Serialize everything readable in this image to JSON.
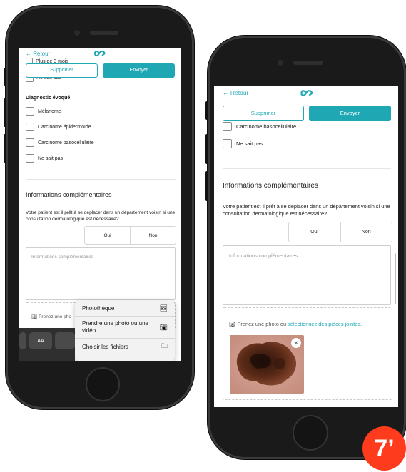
{
  "left": {
    "nav": {
      "back": "← Retour"
    },
    "buttons": {
      "delete": "Supprimer",
      "send": "Envoyer"
    },
    "partial_options": [
      "Plus de 3 mois",
      "Ne sait pas"
    ],
    "diagnostic": {
      "title": "Diagnostic évoqué",
      "options": [
        "Mélanome",
        "Carcinome épidermoïde",
        "Carcinome basocellulaire",
        "Ne sait pas"
      ]
    },
    "info": {
      "title": "Informations complémentaires",
      "question": "Votre patient est il prêt à se déplacer dans un département voisin si une consultation dermatologique est nécessaire?",
      "yes": "Oui",
      "no": "Non",
      "placeholder": "Informations complémentaires",
      "upload": "Prenez une pho"
    },
    "menu": [
      "Photothèque",
      "Prendre une photo ou une vidéo",
      "Choisir les fichiers"
    ],
    "keyboard": {
      "aa": "AA"
    }
  },
  "right": {
    "nav": {
      "back": "← Retour"
    },
    "buttons": {
      "delete": "Supprimer",
      "send": "Envoyer"
    },
    "options": [
      "Carcinome basocellulaire",
      "Ne sait pas"
    ],
    "info": {
      "title": "Informations complémentaires",
      "question": "Votre patient est il prêt à se déplacer dans un département voisin si une consultation dermatologique est nécessaire?",
      "yes": "Oui",
      "no": "Non",
      "placeholder": "Informations complémentaires",
      "upload_text": "Prenez une photo ou",
      "upload_link": "sélectionnez des pièces jointes",
      "upload_end": "."
    },
    "remove": "×"
  },
  "badge": "7’",
  "colors": {
    "accent": "#1fa7b3",
    "badge": "#ff3b1d"
  }
}
